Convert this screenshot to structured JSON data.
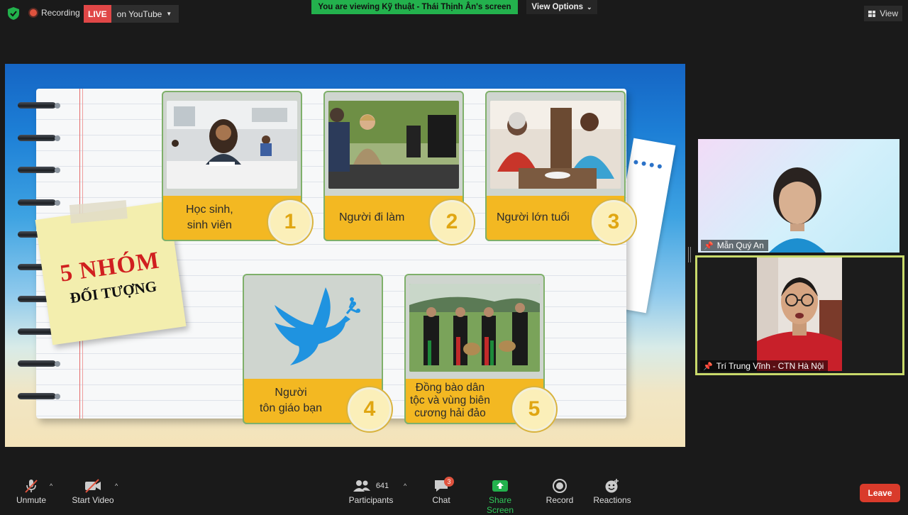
{
  "topbar": {
    "recording_label": "Recording",
    "live_label": "LIVE",
    "youtube_label": "on YouTube",
    "share_banner": "You are viewing Kỹ thuật - Thái Thịnh Ân's screen",
    "view_options_label": "View Options",
    "view_label": "View"
  },
  "slide": {
    "sticky_line1": "5 NHÓM",
    "sticky_line2": "ĐỐI TƯỢNG",
    "cards": [
      {
        "label": "Học sinh,\nsinh viên",
        "number": "1"
      },
      {
        "label": "Người đi làm",
        "number": "2"
      },
      {
        "label": "Người lớn tuổi",
        "number": "3"
      },
      {
        "label": "Người\ntôn giáo bạn",
        "number": "4"
      },
      {
        "label": "Đồng bào dân\ntộc và vùng biên\ncương hải đảo",
        "number": "5"
      }
    ]
  },
  "participants_video": [
    {
      "name": "Mẫn Quý An"
    },
    {
      "name": "Trí Trung Vĩnh - CTN Hà Nội"
    }
  ],
  "toolbar": {
    "unmute": "Unmute",
    "start_video": "Start Video",
    "participants_count": "641",
    "participants": "Participants",
    "chat": "Chat",
    "chat_badge": "3",
    "share_screen": "Share Screen",
    "record": "Record",
    "reactions": "Reactions",
    "leave": "Leave"
  },
  "colors": {
    "share_green": "#23b14d",
    "live_red": "#e04747",
    "label_yellow": "#f3b822",
    "leave_red": "#d93b2b"
  }
}
